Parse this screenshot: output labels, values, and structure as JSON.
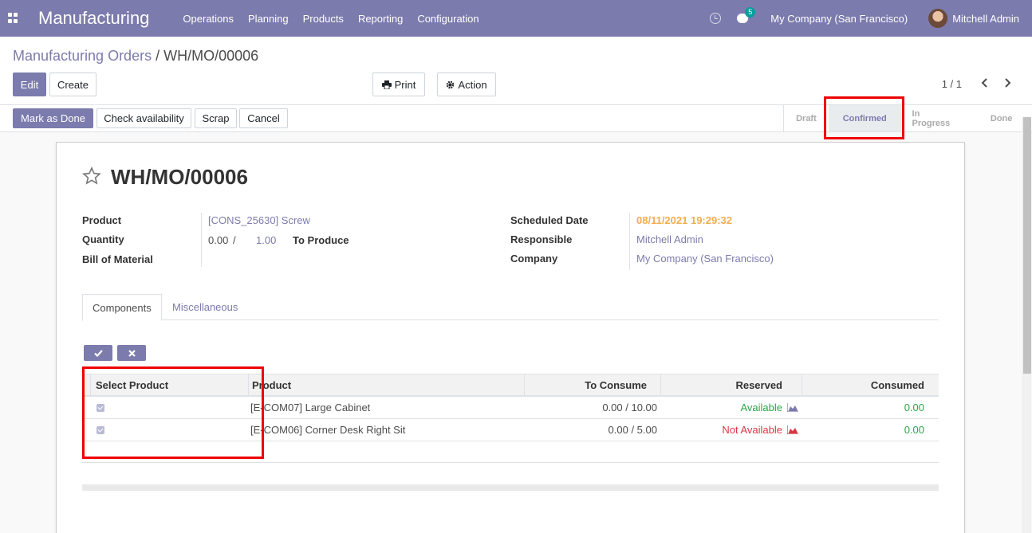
{
  "navbar": {
    "brand": "Manufacturing",
    "menu": [
      "Operations",
      "Planning",
      "Products",
      "Reporting",
      "Configuration"
    ],
    "chat_count": "5",
    "company": "My Company (San Francisco)",
    "user": "Mitchell Admin"
  },
  "breadcrumb": {
    "parent": "Manufacturing Orders",
    "separator": "/",
    "current": "WH/MO/00006"
  },
  "toolbar": {
    "edit": "Edit",
    "create": "Create",
    "print": "Print",
    "action": "Action",
    "pager": "1 / 1"
  },
  "status_buttons": {
    "mark_done": "Mark as Done",
    "check_availability": "Check availability",
    "scrap": "Scrap",
    "cancel": "Cancel"
  },
  "stages": [
    "Draft",
    "Confirmed",
    "In Progress",
    "Done"
  ],
  "active_stage": "Confirmed",
  "record": {
    "title": "WH/MO/00006",
    "product_label": "Product",
    "product_value": "[CONS_25630] Screw",
    "quantity_label": "Quantity",
    "quantity_done": "0.00",
    "quantity_sep": "/",
    "quantity_total": "1.00",
    "to_produce": "To Produce",
    "bom_label": "Bill of Material",
    "scheduled_label": "Scheduled Date",
    "scheduled_value": "08/11/2021 19:29:32",
    "responsible_label": "Responsible",
    "responsible_value": "Mitchell Admin",
    "company_label": "Company",
    "company_value": "My Company (San Francisco)"
  },
  "tabs": [
    "Components",
    "Miscellaneous"
  ],
  "table": {
    "headers": [
      "Select Product",
      "Product",
      "To Consume",
      "Reserved",
      "Consumed"
    ],
    "rows": [
      {
        "product": "[E-COM07] Large Cabinet",
        "to_consume": "0.00 / 10.00",
        "reserved": "Available",
        "consumed": "0.00"
      },
      {
        "product": "[E-COM06] Corner Desk Right Sit",
        "to_consume": "0.00 / 5.00",
        "reserved": "Not Available",
        "consumed": "0.00"
      }
    ]
  },
  "colors": {
    "brand": "#7c7bad",
    "available": "#28a745",
    "not_available": "#dc3545",
    "scheduled": "#f0ad4e",
    "highlight": "#ee0000"
  }
}
